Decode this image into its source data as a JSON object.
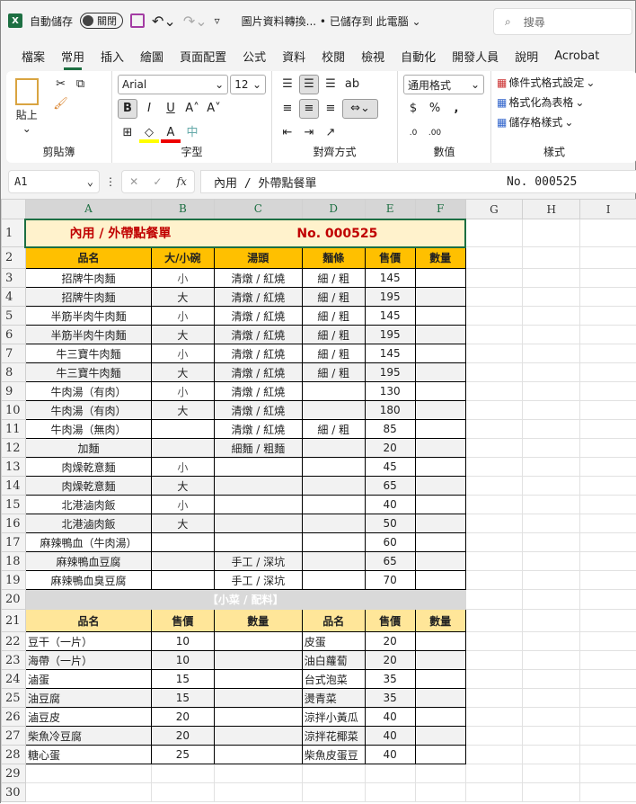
{
  "titlebar": {
    "autosave": "自動儲存",
    "toggle": "關閉",
    "doc": "圖片資料轉換... • 已儲存到 此電腦 ⌄",
    "search": "搜尋"
  },
  "tabs": [
    "檔案",
    "常用",
    "插入",
    "繪圖",
    "頁面配置",
    "公式",
    "資料",
    "校閱",
    "檢視",
    "自動化",
    "開發人員",
    "說明",
    "Acrobat"
  ],
  "ribbon": {
    "paste": "貼上",
    "clipboard": "剪貼簿",
    "font": "Arial",
    "size": "12",
    "font_group": "字型",
    "align_group": "對齊方式",
    "number_format": "通用格式",
    "number_group": "數值",
    "cond": "條件式格式設定",
    "table": "格式化為表格",
    "styles_btn": "儲存格樣式",
    "styles_group": "樣式"
  },
  "formula_bar": {
    "cell": "A1",
    "fx": "fx",
    "content": "內用 / 外帶點餐單",
    "content2": "No. 000525"
  },
  "columns": [
    "A",
    "B",
    "C",
    "D",
    "E",
    "F",
    "G",
    "H",
    "I"
  ],
  "sheet": {
    "title": "內用 / 外帶點餐單",
    "number": "No. 000525",
    "headers": [
      "品名",
      "大/小碗",
      "湯頭",
      "麵條",
      "售價",
      "數量"
    ],
    "items": [
      [
        "招牌牛肉麵",
        "小",
        "清燉 / 紅燒",
        "細 / 粗",
        "145"
      ],
      [
        "招牌牛肉麵",
        "大",
        "清燉 / 紅燒",
        "細 / 粗",
        "195"
      ],
      [
        "半筋半肉牛肉麵",
        "小",
        "清燉 / 紅燒",
        "細 / 粗",
        "145"
      ],
      [
        "半筋半肉牛肉麵",
        "大",
        "清燉 / 紅燒",
        "細 / 粗",
        "195"
      ],
      [
        "牛三寶牛肉麵",
        "小",
        "清燉 / 紅燒",
        "細 / 粗",
        "145"
      ],
      [
        "牛三寶牛肉麵",
        "大",
        "清燉 / 紅燒",
        "細 / 粗",
        "195"
      ],
      [
        "牛肉湯（有肉）",
        "小",
        "清燉 / 紅燒",
        "",
        "130"
      ],
      [
        "牛肉湯（有肉）",
        "大",
        "清燉 / 紅燒",
        "",
        "180"
      ],
      [
        "牛肉湯（無肉）",
        "",
        "清燉 / 紅燒",
        "細 / 粗",
        "85"
      ],
      [
        "加麵",
        "",
        "細麵 / 粗麵",
        "",
        "20"
      ],
      [
        "肉燥乾意麵",
        "小",
        "",
        "",
        "45"
      ],
      [
        "肉燥乾意麵",
        "大",
        "",
        "",
        "65"
      ],
      [
        "北港滷肉飯",
        "小",
        "",
        "",
        "40"
      ],
      [
        "北港滷肉飯",
        "大",
        "",
        "",
        "50"
      ],
      [
        "麻辣鴨血（牛肉湯）",
        "",
        "",
        "",
        "60"
      ],
      [
        "麻辣鴨血豆腐",
        "",
        "手工 / 深坑",
        "",
        "65"
      ],
      [
        "麻辣鴨血臭豆腐",
        "",
        "手工 / 深坑",
        "",
        "70"
      ]
    ],
    "side_title": "【小菜 / 配料】",
    "side_headers": [
      "品名",
      "售價",
      "數量",
      "品名",
      "售價",
      "數量"
    ],
    "sides": [
      [
        "豆干（一片）",
        "10",
        "皮蛋",
        "20"
      ],
      [
        "海帶（一片）",
        "10",
        "油白蘿蔔",
        "20"
      ],
      [
        "滷蛋",
        "15",
        "台式泡菜",
        "35"
      ],
      [
        "油豆腐",
        "15",
        "燙青菜",
        "35"
      ],
      [
        "滷豆皮",
        "20",
        "涼拌小黃瓜",
        "40"
      ],
      [
        "柴魚冷豆腐",
        "20",
        "涼拌花椰菜",
        "40"
      ],
      [
        "糖心蛋",
        "25",
        "柴魚皮蛋豆",
        "40"
      ]
    ]
  }
}
